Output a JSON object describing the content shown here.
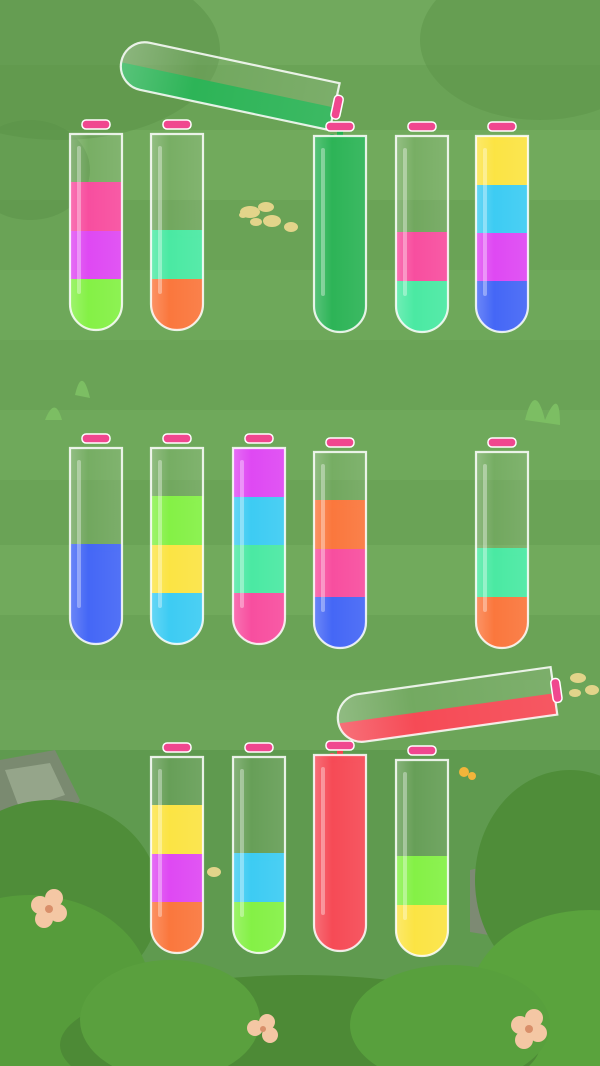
{
  "colors": {
    "pink": "#f7459a",
    "magenta": "#dd3ff2",
    "lime": "#7ef03c",
    "mint": "#41e89e",
    "orange": "#fa7033",
    "green": "#22b04e",
    "yellow": "#fbe23a",
    "cyan": "#33c9f2",
    "blue": "#3b5ff5",
    "red": "#f5414d"
  },
  "bottles": [
    {
      "id": "r1-1",
      "layers": [
        "lime",
        "magenta",
        "pink"
      ]
    },
    {
      "id": "r1-2",
      "layers": [
        "orange",
        "mint"
      ]
    },
    {
      "id": "r1-3",
      "layers": [
        "green",
        "green",
        "green",
        "green"
      ],
      "receiving": true
    },
    {
      "id": "r1-4",
      "layers": [
        "mint",
        "pink"
      ]
    },
    {
      "id": "r1-5",
      "layers": [
        "blue",
        "magenta",
        "cyan",
        "yellow"
      ]
    },
    {
      "id": "r2-1",
      "layers": [
        "blue",
        "blue"
      ]
    },
    {
      "id": "r2-2",
      "layers": [
        "cyan",
        "yellow",
        "lime"
      ]
    },
    {
      "id": "r2-3",
      "layers": [
        "pink",
        "mint",
        "cyan",
        "magenta"
      ]
    },
    {
      "id": "r2-4",
      "layers": [
        "blue",
        "pink",
        "orange"
      ]
    },
    {
      "id": "r2-5",
      "layers": [
        "orange",
        "mint"
      ]
    },
    {
      "id": "r3-1",
      "layers": [
        "orange",
        "magenta",
        "yellow"
      ]
    },
    {
      "id": "r3-2",
      "layers": [
        "lime",
        "cyan"
      ]
    },
    {
      "id": "r3-3",
      "layers": [
        "red",
        "red",
        "red",
        "red"
      ],
      "receiving": true
    },
    {
      "id": "r3-4",
      "layers": [
        "yellow",
        "lime"
      ]
    }
  ],
  "pouring": [
    {
      "id": "pour-green",
      "color": "green"
    },
    {
      "id": "pour-red",
      "color": "red"
    }
  ]
}
